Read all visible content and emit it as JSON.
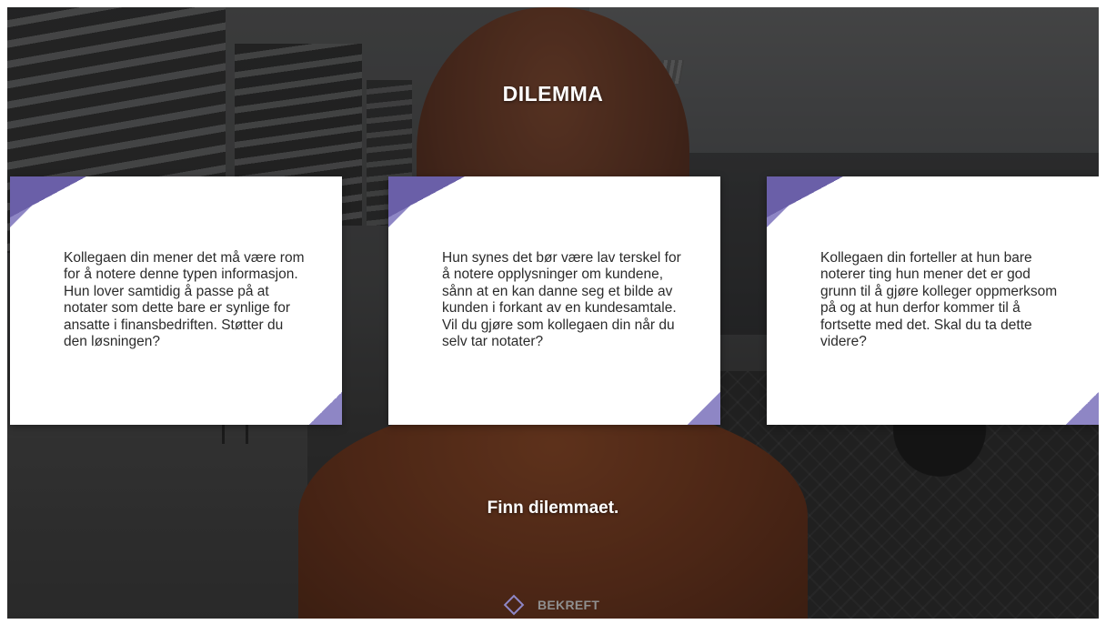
{
  "title": "DILEMMA",
  "cards": [
    {
      "text": "Kollegaen din mener det må være rom for å notere denne typen informasjon. Hun lover samtidig å passe på at notater som dette bare er synlige for ansatte i finansbedriften. Støtter du den løsningen?"
    },
    {
      "text": "Hun synes det bør være lav terskel for å notere opplysninger om kundene, sånn at en kan danne seg et bilde av kunden i forkant av en kundesamtale. Vil du gjøre som kollegaen din når du selv tar notater?"
    },
    {
      "text": "Kollegaen din forteller at hun bare noterer ting hun mener det er god grunn til å gjøre kolleger oppmerksom på og at hun derfor kommer til å fortsette med det. Skal du ta dette videre?"
    }
  ],
  "instruction": "Finn dilemmaet.",
  "confirm_button": {
    "label": "BEKREFT",
    "icon": "diamond-icon"
  },
  "colors": {
    "accent": "#8e86c5",
    "accent_dark": "#6a5fa8",
    "card_bg": "#ffffff"
  }
}
